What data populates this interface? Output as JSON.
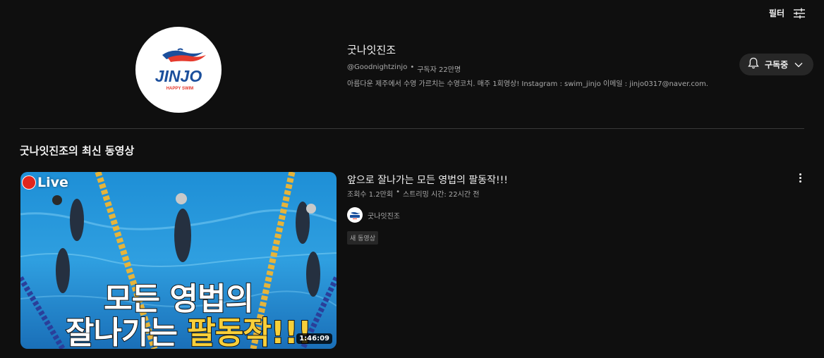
{
  "filter": {
    "label": "필터",
    "icon": "sliders-icon"
  },
  "channel": {
    "name": "굿나잇진조",
    "handle": "@Goodnightzinjo",
    "separator": "•",
    "subscribers": "구독자 22만명",
    "description": "아름다운 제주에서 수영 가르치는 수영코치. 매주 1회영상! Instagram : swim_jinjo 이메일 : jinjo0317@naver.com.",
    "logo": {
      "text": "JINJO",
      "subtext": "HAPPY SWIM",
      "brand_color": "#1b4f9c",
      "accent_color": "#e63b2e"
    }
  },
  "subscribe": {
    "label": "구독중",
    "icon": "bell-icon",
    "chevron": "chevron-down-icon"
  },
  "section": {
    "title": "굿나잇진조의 최신 동영상"
  },
  "video": {
    "title": "앞으로 잘나가는 모든 영법의 팔동작!!!",
    "views": "조회수 1.2만회",
    "separator": "•",
    "streamed": "스트리밍 시간: 22시간 전",
    "channel_name": "굿나잇진조",
    "badge": "새 동영상",
    "duration": "1:46:09",
    "thumbnail": {
      "live_label": "Live",
      "line1": "모든 영법의",
      "line2_white": "잘나가는 ",
      "line2_yellow": "팔동작!!!"
    },
    "more_icon": "more-vert-icon"
  },
  "colors": {
    "background": "#0f0f0f",
    "text": "#f1f1f1",
    "secondary_text": "#aaaaaa",
    "button_bg": "#272727",
    "live_red": "#e1261c",
    "thumb_yellow": "#f7cf3a"
  }
}
